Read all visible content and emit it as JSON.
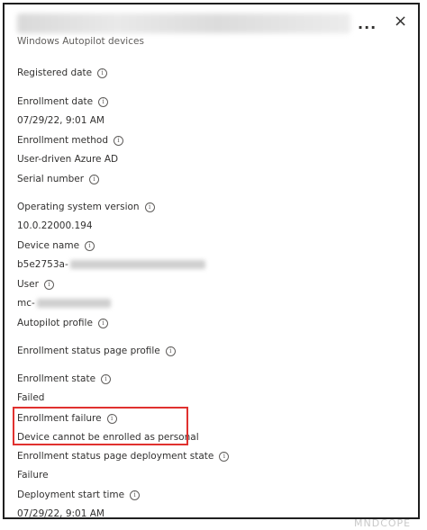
{
  "header": {
    "subtitle": "Windows Autopilot devices",
    "more_label": "...",
    "close_label": "×"
  },
  "fields": [
    {
      "label": "Registered date",
      "value": ""
    },
    {
      "label": "Enrollment date",
      "value": "07/29/22, 9:01 AM"
    },
    {
      "label": "Enrollment method",
      "value": "User-driven Azure AD"
    },
    {
      "label": "Serial number",
      "value": ""
    },
    {
      "label": "Operating system version",
      "value": "10.0.22000.194"
    },
    {
      "label": "Device name",
      "value": "b5e2753a-"
    },
    {
      "label": "User",
      "value": "mc-"
    },
    {
      "label": "Autopilot profile",
      "value": ""
    },
    {
      "label": "Enrollment status page profile",
      "value": ""
    },
    {
      "label": "Enrollment state",
      "value": "Failed"
    },
    {
      "label": "Enrollment failure",
      "value": "Device cannot be enrolled as personal"
    },
    {
      "label": "Enrollment status page deployment state",
      "value": "Failure"
    },
    {
      "label": "Deployment start time",
      "value": "07/29/22, 9:01 AM"
    }
  ],
  "colors": {
    "highlight": "#e0312f"
  },
  "icons": {
    "info": "info-icon",
    "more": "more-icon",
    "close": "close-icon"
  },
  "watermark": "MNDCOPE"
}
